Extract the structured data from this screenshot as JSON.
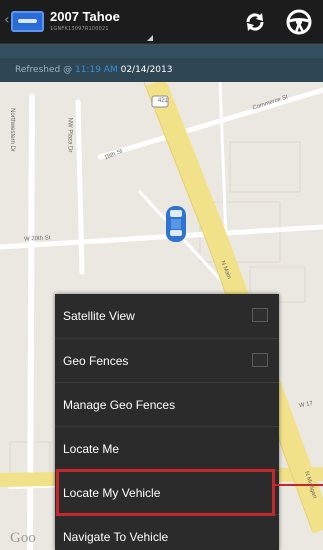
{
  "header": {
    "vehicle_name": "2007 Tahoe",
    "vehicle_subtext": "1GNFK13097R100021",
    "icons": {
      "back": "chevron-left-icon",
      "logo": "app-logo-icon",
      "refresh": "refresh-icon",
      "steering": "steering-wheel-icon"
    }
  },
  "status": {
    "refreshed_label": "Refreshed @",
    "time": "11:19 AM",
    "date": "02/14/2013"
  },
  "map": {
    "streets": [
      "Commerce St",
      "18th St",
      "W 20th St",
      "Northwestern Dr",
      "NW Plaza Dr",
      "N Main",
      "N Mulligan",
      "W 17"
    ],
    "route_number": "421",
    "attribution": "Goo"
  },
  "menu": {
    "items": [
      {
        "label": "Satellite View",
        "checkbox": true
      },
      {
        "label": "Geo Fences",
        "checkbox": true
      },
      {
        "label": "Manage Geo Fences",
        "checkbox": false
      },
      {
        "label": "Locate Me",
        "checkbox": false
      },
      {
        "label": "Locate My Vehicle",
        "checkbox": false,
        "highlighted": true
      },
      {
        "label": "Navigate To Vehicle",
        "checkbox": false
      }
    ]
  },
  "colors": {
    "highlight": "#c4272c",
    "road_yellow": "#f1e28a",
    "appbar": "#1c1c1c",
    "time_accent": "#3a8fd6"
  }
}
